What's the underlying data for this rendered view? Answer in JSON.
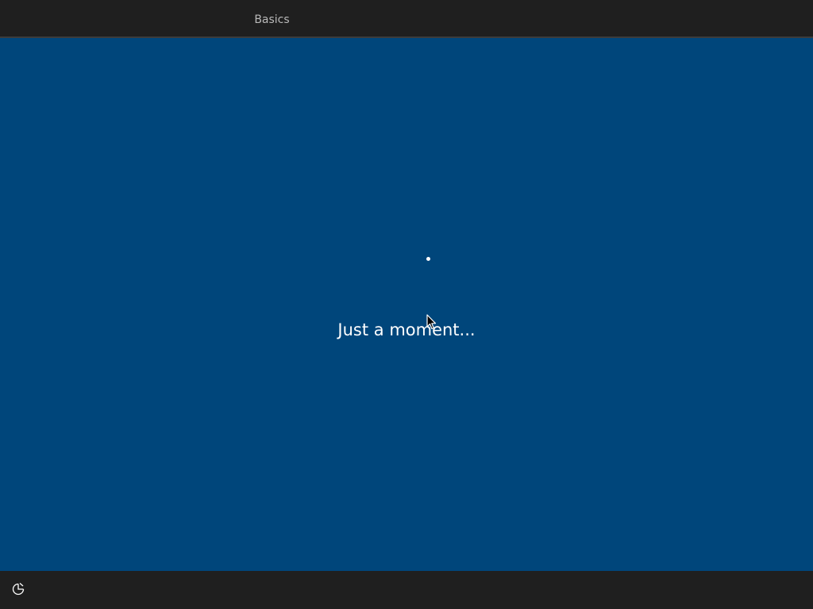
{
  "header": {
    "tabs": [
      {
        "label": "Basics",
        "selected": true
      }
    ]
  },
  "main": {
    "status_text": "Just a moment...",
    "background_color": "#00467b"
  },
  "footer": {
    "accessibility_icon": "ease-of-access-icon"
  }
}
